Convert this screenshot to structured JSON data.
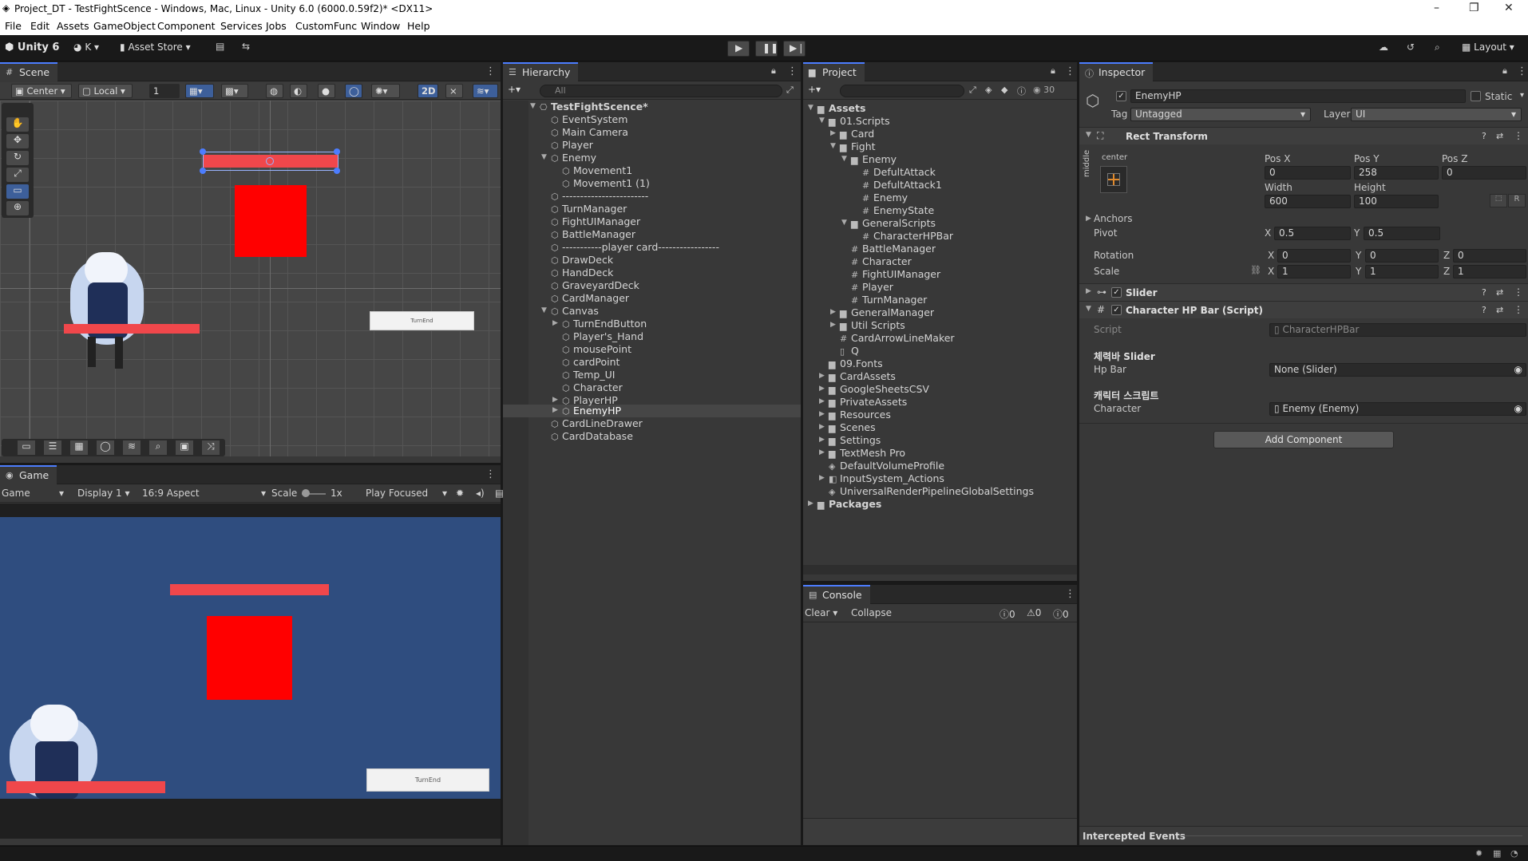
{
  "window": {
    "title": "Project_DT - TestFightScence - Windows, Mac, Linux - Unity 6.0 (6000.0.59f2)* <DX11>"
  },
  "menu": [
    "File",
    "Edit",
    "Assets",
    "GameObject",
    "Component",
    "Services",
    "Jobs",
    "CustomFunc",
    "Window",
    "Help"
  ],
  "toolbar": {
    "account": "Unity 6",
    "user": "K",
    "asset_store": "Asset Store",
    "layout": "Layout"
  },
  "scene": {
    "tab": "Scene",
    "pivot": "Center",
    "space": "Local",
    "grid_value": "1",
    "mode_2d": "2D",
    "turn_end_label": "TurnEnd"
  },
  "game": {
    "tab": "Game",
    "view": "Game",
    "display": "Display 1",
    "aspect": "16:9 Aspect",
    "scale_label": "Scale",
    "scale_value": "1x",
    "play_mode": "Play Focused",
    "turn_end_label": "TurnEnd"
  },
  "hierarchy": {
    "tab": "Hierarchy",
    "search_placeholder": "All",
    "scene_name": "TestFightScence*",
    "rows": [
      "EventSystem",
      "Main Camera",
      "Player",
      "Enemy",
      "Movement1",
      "Movement1 (1)",
      "------------------------",
      "TurnManager",
      "FightUIManager",
      "BattleManager",
      "-----------player card-----------------",
      "DrawDeck",
      "HandDeck",
      "GraveyardDeck",
      "CardManager",
      "Canvas",
      "TurnEndButton",
      "Player's_Hand",
      "mousePoint",
      "cardPoint",
      "Temp_UI",
      "Character",
      "PlayerHP",
      "EnemyHP",
      "CardLineDrawer",
      "CardDatabase"
    ]
  },
  "project": {
    "tab": "Project",
    "count": "30",
    "rows": [
      "Assets",
      "01.Scripts",
      "Card",
      "Fight",
      "Enemy",
      "DefultAttack",
      "DefultAttack1",
      "Enemy",
      "EnemyState",
      "GeneralScripts",
      "CharacterHPBar",
      "BattleManager",
      "Character",
      "FightUIManager",
      "Player",
      "TurnManager",
      "GeneralManager",
      "Util Scripts",
      "CardArrowLineMaker",
      "Q",
      "09.Fonts",
      "CardAssets",
      "GoogleSheetsCSV",
      "PrivateAssets",
      "Resources",
      "Scenes",
      "Settings",
      "TextMesh Pro",
      "DefaultVolumeProfile",
      "InputSystem_Actions",
      "UniversalRenderPipelineGlobalSettings",
      "Packages"
    ]
  },
  "console": {
    "tab": "Console",
    "clear": "Clear",
    "collapse": "Collapse",
    "logs": "0",
    "warnings": "0",
    "errors": "0"
  },
  "inspector": {
    "tab": "Inspector",
    "object_name": "EnemyHP",
    "static_label": "Static",
    "tag_label": "Tag",
    "tag_value": "Untagged",
    "layer_label": "Layer",
    "layer_value": "UI",
    "rect_transform": {
      "title": "Rect Transform",
      "anchor_h": "center",
      "anchor_v": "middle",
      "pos_x_label": "Pos X",
      "pos_x": "0",
      "pos_y_label": "Pos Y",
      "pos_y": "258",
      "pos_z_label": "Pos Z",
      "pos_z": "0",
      "width_label": "Width",
      "width": "600",
      "height_label": "Height",
      "height": "100",
      "anchors_label": "Anchors",
      "pivot_label": "Pivot",
      "pivot_x": "0.5",
      "pivot_y": "0.5",
      "rotation_label": "Rotation",
      "rot_x": "0",
      "rot_y": "0",
      "rot_z": "0",
      "scale_label": "Scale",
      "scale_x": "1",
      "scale_y": "1",
      "scale_z": "1",
      "x": "X",
      "y": "Y",
      "z": "Z",
      "r": "R"
    },
    "slider": {
      "title": "Slider"
    },
    "hpbar": {
      "title": "Character HP Bar (Script)",
      "script_label": "Script",
      "script_value": "CharacterHPBar",
      "section1": "체력바 Slider",
      "hp_bar_label": "Hp Bar",
      "hp_bar_value": "None (Slider)",
      "section2": "캐릭터 스크립트",
      "character_label": "Character",
      "character_value": "Enemy (Enemy)"
    },
    "add_component": "Add Component",
    "intercepted_events": "Intercepted Events"
  },
  "colors": {
    "accent": "#4c7dff",
    "hp_bar": "#f0474b",
    "enemy_red": "#ff0000",
    "game_bg": "#2f4d7f"
  }
}
